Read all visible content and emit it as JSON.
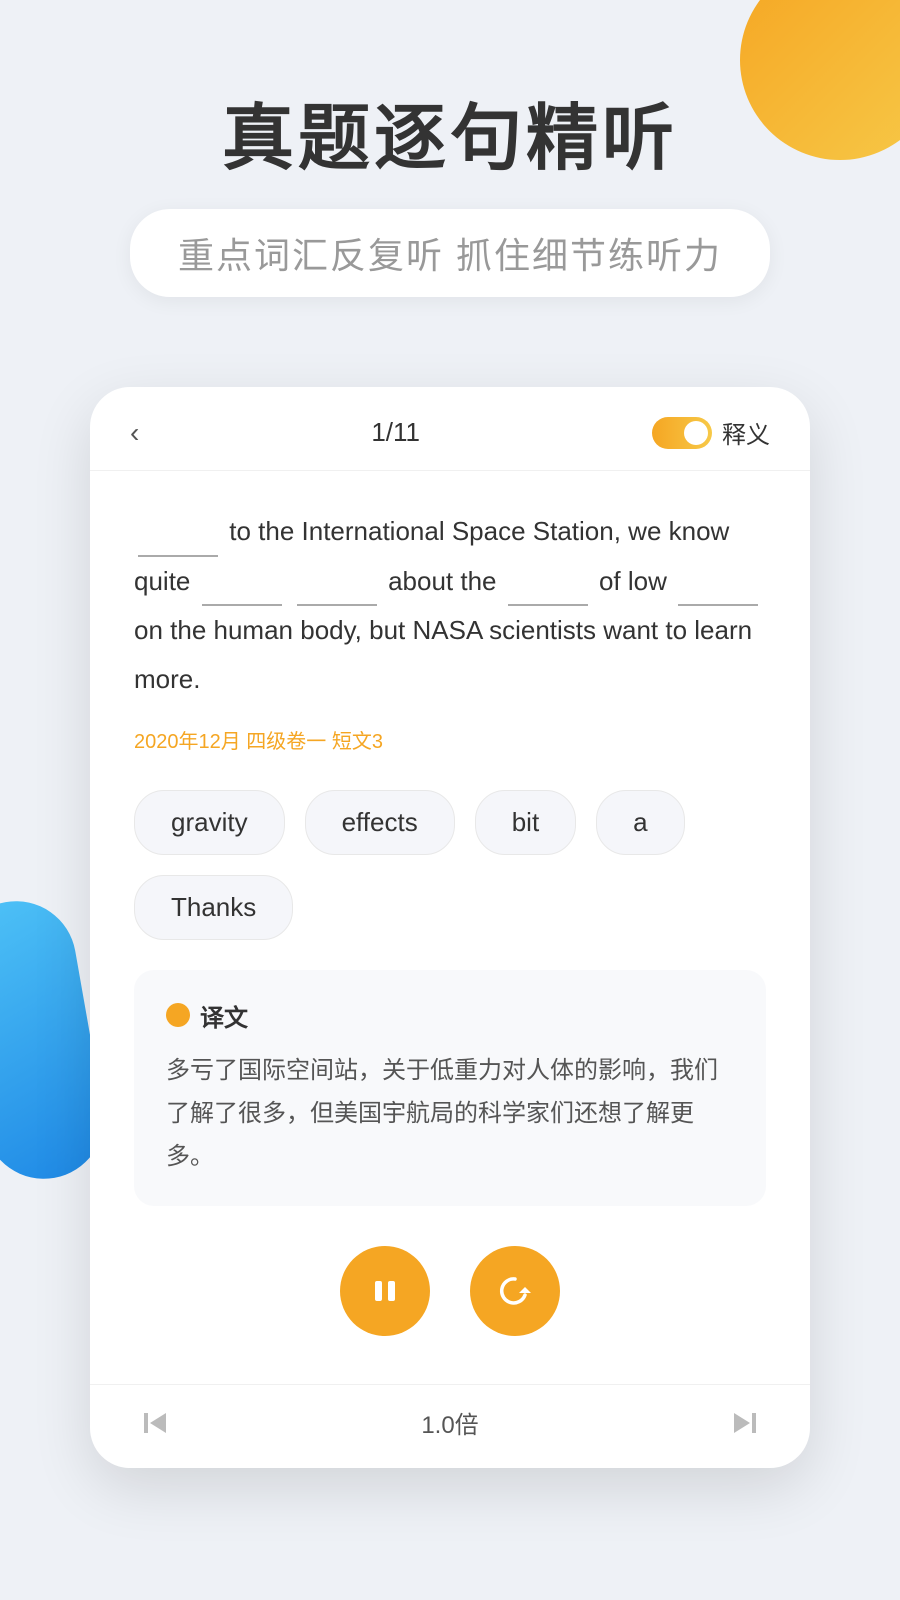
{
  "background": {
    "orange_circle": "top-right decorative circle",
    "blue_shape": "left-side decorative blob"
  },
  "header": {
    "main_title": "真题逐句精听",
    "subtitle": "重点词汇反复听  抓住细节练听力"
  },
  "card": {
    "back_button": "‹",
    "page_counter": "1/11",
    "toggle_label": "释义",
    "sentence": {
      "parts": [
        "_______ to the International Space Station, we know quite _______ _______ about the _______ of low _______ on the human body, but NASA scientists want to learn more."
      ]
    },
    "source": "2020年12月 四级卷一 短文3",
    "word_chips": [
      {
        "id": "gravity",
        "label": "gravity",
        "selected": false
      },
      {
        "id": "effects",
        "label": "effects",
        "selected": false
      },
      {
        "id": "bit",
        "label": "bit",
        "selected": false
      },
      {
        "id": "a",
        "label": "a",
        "selected": false
      },
      {
        "id": "thanks",
        "label": "Thanks",
        "selected": false
      }
    ],
    "translation": {
      "title": "译文",
      "text": "多亏了国际空间站，关于低重力对人体的影响，我们了解了很多，但美国宇航局的科学家们还想了解更多。"
    },
    "controls": {
      "pause_btn": "pause",
      "replay_btn": "replay"
    },
    "bottom_bar": {
      "skip_prev": "⏮",
      "speed": "1.0倍",
      "skip_next": "⏭"
    }
  }
}
